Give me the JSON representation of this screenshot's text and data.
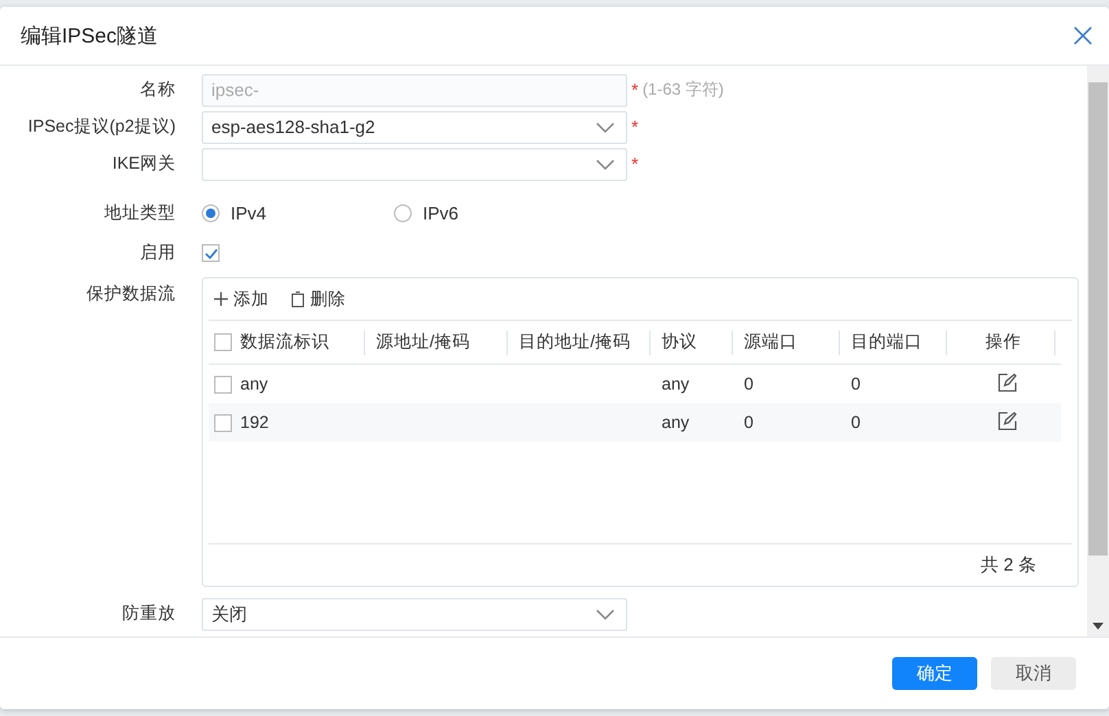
{
  "dialog": {
    "title": "编辑IPSec隧道"
  },
  "fields": [
    {
      "kind": "text",
      "label": "名称",
      "value": "ipsec-",
      "required_mark": "*",
      "hint": "(1-63 字符)",
      "disabled": true
    },
    {
      "kind": "select",
      "label": "IPSec提议(p2提议)",
      "value": "esp-aes128-sha1-g2",
      "required_mark": "*"
    },
    {
      "kind": "select",
      "label": "IKE网关",
      "required_mark": "*"
    },
    {
      "kind": "radio",
      "label": "地址类型",
      "options": [
        {
          "label": "IPv4",
          "selected": true
        },
        {
          "label": "IPv6",
          "selected": false
        }
      ]
    },
    {
      "kind": "checkbox",
      "label": "启用",
      "checked": true
    }
  ],
  "flows": {
    "label": "保护数据流",
    "toolbar": [
      "添加",
      "删除"
    ],
    "all_checked": false,
    "columns": [
      "数据流标识",
      "源地址/掩码",
      "目的地址/掩码",
      "协议",
      "源端口",
      "目的端口",
      "操作"
    ],
    "rows": [
      {
        "checked": false,
        "cells": [
          "any",
          "",
          "",
          "any",
          "0",
          "0"
        ]
      },
      {
        "checked": false,
        "cells": [
          "192",
          "",
          "",
          "any",
          "0",
          "0"
        ]
      }
    ],
    "total": "共 2 条"
  },
  "replay": {
    "label": "防重放",
    "value": "关闭"
  },
  "buttons": [
    {
      "label": "确定",
      "kind": "primary"
    },
    {
      "label": "取消",
      "kind": "secondary"
    }
  ]
}
